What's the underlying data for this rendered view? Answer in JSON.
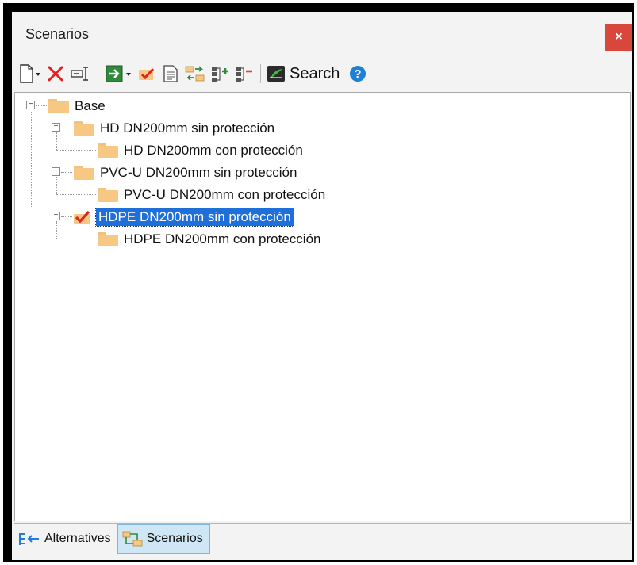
{
  "window": {
    "title": "Scenarios",
    "close_label": "×"
  },
  "toolbar": {
    "new": "new-document-icon",
    "delete": "delete-icon",
    "rename": "rename-icon",
    "compute": "compute-icon",
    "make_current": "make-current-icon",
    "properties": "properties-icon",
    "compare": "compare-icon",
    "expand_all": "expand-all-icon",
    "collapse_all": "collapse-all-icon",
    "search_label": "Search",
    "help": "help-icon"
  },
  "tree": {
    "nodes": [
      {
        "label": "Base"
      },
      {
        "label": "HD DN200mm sin protección"
      },
      {
        "label": "HD DN200mm con protección"
      },
      {
        "label": "PVC-U DN200mm sin protección"
      },
      {
        "label": "PVC-U DN200mm con protección"
      },
      {
        "label": "HDPE DN200mm sin protección",
        "selected": true
      },
      {
        "label": "HDPE DN200mm con protección"
      }
    ]
  },
  "tabs": [
    {
      "label": "Alternatives",
      "active": false
    },
    {
      "label": "Scenarios",
      "active": true
    }
  ],
  "colors": {
    "selection": "#1e6fd9",
    "close": "#d9473c",
    "folder": "#f6c884",
    "active_tab": "#cfe7f5"
  }
}
